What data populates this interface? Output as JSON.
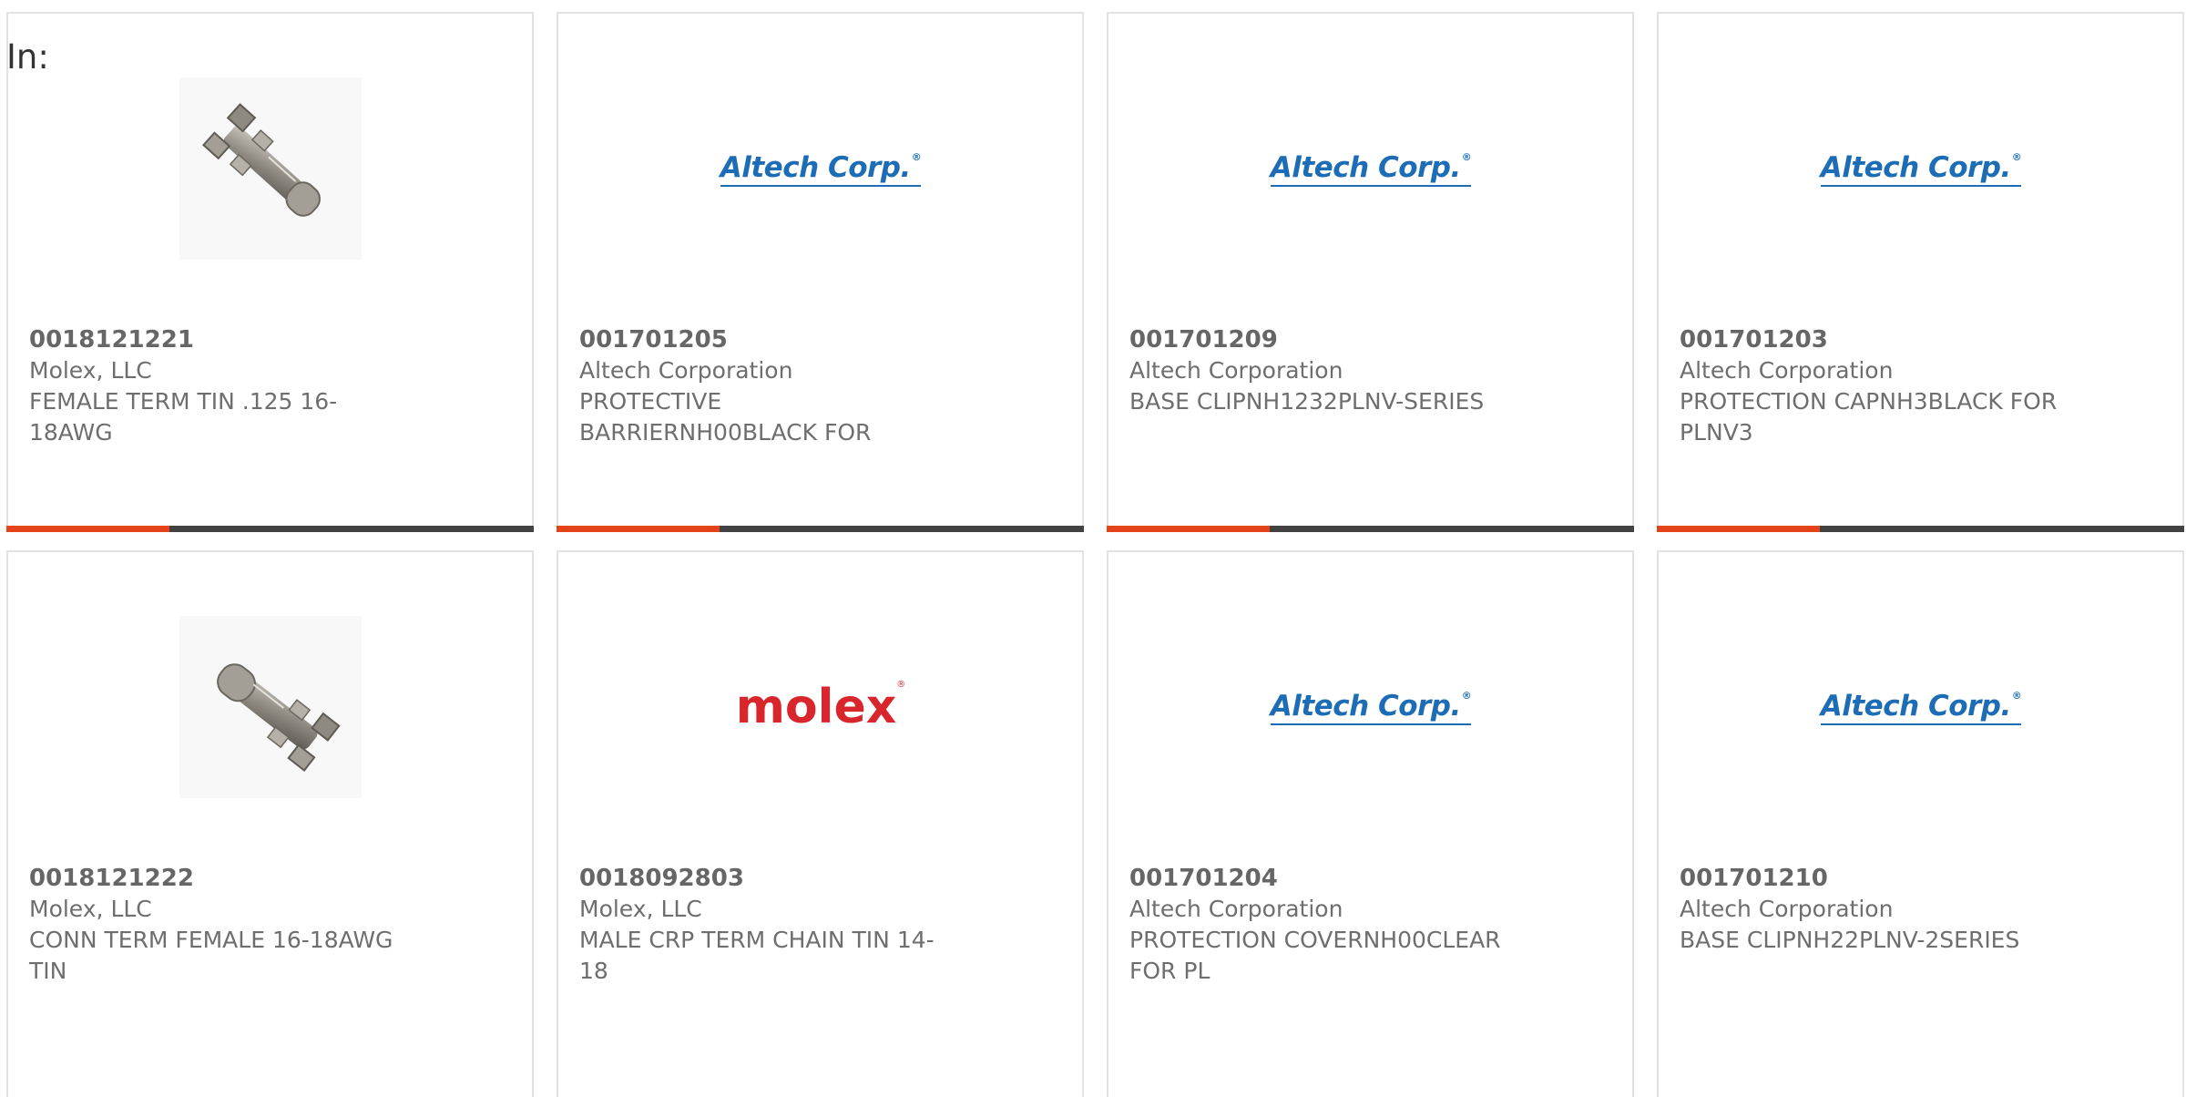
{
  "filter": {
    "label": "In:"
  },
  "accent_color": "#e5431a",
  "track_color": "#424242",
  "cards": [
    {
      "part_number": "0018121221",
      "manufacturer": "Molex, LLC",
      "description": "FEMALE TERM TIN .125 16-18AWG",
      "image": "crimp-terminal-photo",
      "progress": 0.31
    },
    {
      "part_number": "001701205",
      "manufacturer": "Altech Corporation",
      "description": "PROTECTIVE BARRIERNH00BLACK FOR",
      "image": "altech-logo",
      "logo_text": "Altech Corp.",
      "progress": 0.31
    },
    {
      "part_number": "001701209",
      "manufacturer": "Altech Corporation",
      "description": "BASE CLIPNH1232PLNV-SERIES",
      "image": "altech-logo",
      "logo_text": "Altech Corp.",
      "progress": 0.31
    },
    {
      "part_number": "001701203",
      "manufacturer": "Altech Corporation",
      "description": "PROTECTION CAPNH3BLACK FOR PLNV3",
      "image": "altech-logo",
      "logo_text": "Altech Corp.",
      "progress": 0.31
    },
    {
      "part_number": "0018121222",
      "manufacturer": "Molex, LLC",
      "description": "CONN TERM FEMALE 16-18AWG TIN",
      "image": "crimp-terminal-photo"
    },
    {
      "part_number": "0018092803",
      "manufacturer": "Molex, LLC",
      "description": "MALE CRP TERM CHAIN TIN 14-18",
      "image": "molex-logo",
      "logo_text": "molex"
    },
    {
      "part_number": "001701204",
      "manufacturer": "Altech Corporation",
      "description": "PROTECTION COVERNH00CLEAR FOR PL",
      "image": "altech-logo",
      "logo_text": "Altech Corp."
    },
    {
      "part_number": "001701210",
      "manufacturer": "Altech Corporation",
      "description": "BASE CLIPNH22PLNV-2SERIES",
      "image": "altech-logo",
      "logo_text": "Altech Corp."
    }
  ]
}
